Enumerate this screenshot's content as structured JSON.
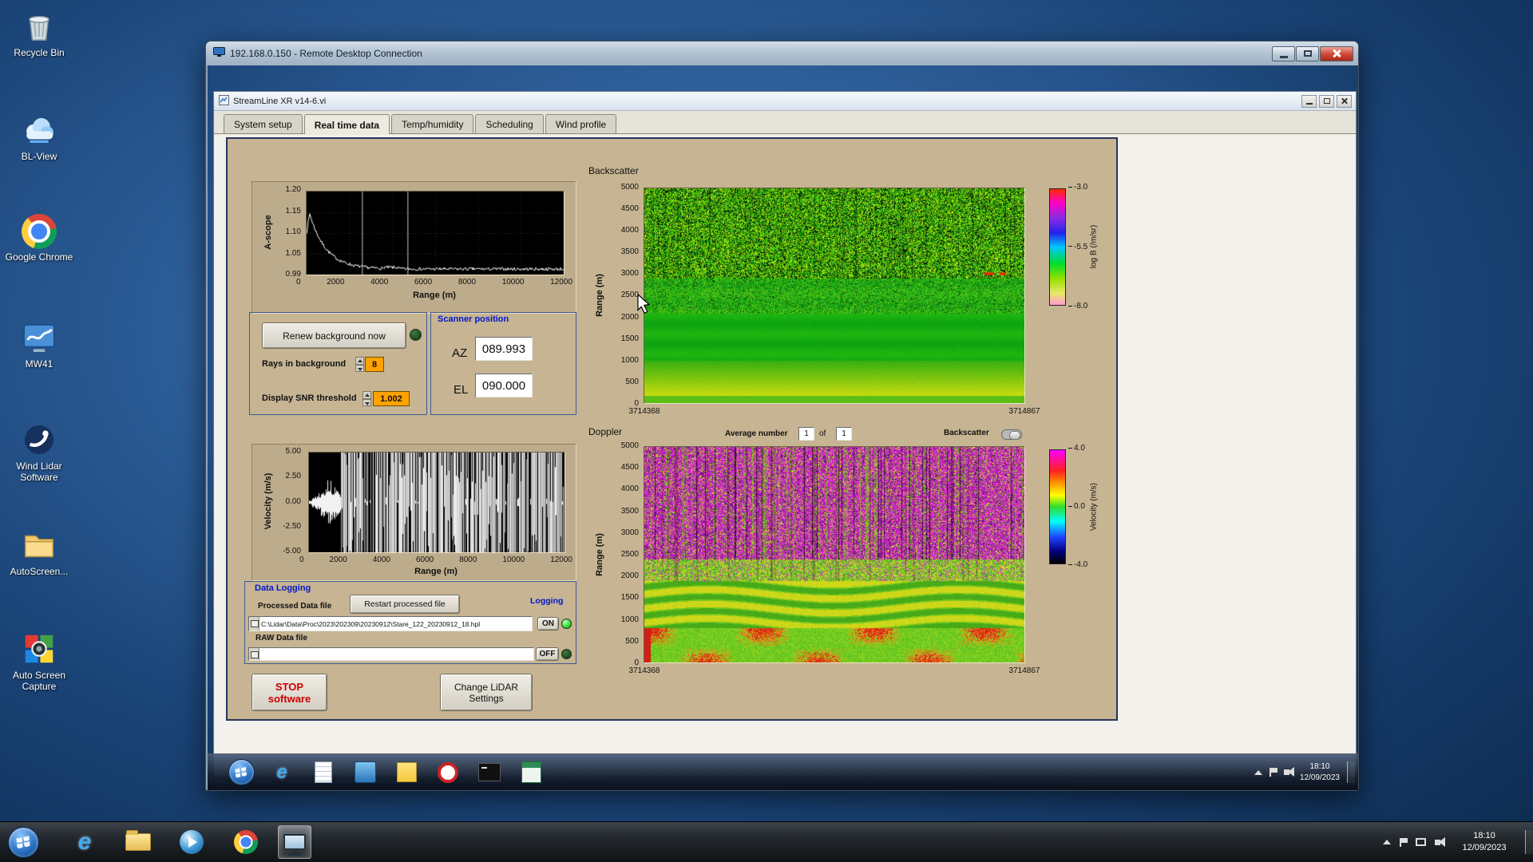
{
  "desktop": {
    "icons": [
      {
        "label": "Recycle Bin"
      },
      {
        "label": "BL-View"
      },
      {
        "label": "Google Chrome"
      },
      {
        "label": "MW41"
      },
      {
        "label": "Wind Lidar Software"
      },
      {
        "label": "AutoScreen..."
      },
      {
        "label": "Auto Screen Capture"
      }
    ]
  },
  "glyphs": {
    "ie": "e"
  },
  "rdp": {
    "title": "192.168.0.150 - Remote Desktop Connection"
  },
  "app": {
    "title": "StreamLine XR v14-6.vi",
    "tabs": [
      {
        "label": "System setup"
      },
      {
        "label": "Real time data"
      },
      {
        "label": "Temp/humidity"
      },
      {
        "label": "Scheduling"
      },
      {
        "label": "Wind profile"
      }
    ]
  },
  "ascope": {
    "y_label": "A-scope",
    "x_label": "Range (m)",
    "y_ticks": [
      "1.20",
      "1.15",
      "1.10",
      "1.05",
      "0.99"
    ],
    "x_ticks": [
      "0",
      "2000",
      "4000",
      "6000",
      "8000",
      "10000",
      "12000"
    ]
  },
  "background_ctrl": {
    "renew": "Renew background now",
    "rays_label": "Rays in background",
    "rays_value": "8",
    "snr_label": "Display SNR threshold",
    "snr_value": "1.002"
  },
  "scanner": {
    "title": "Scanner position",
    "az_label": "AZ",
    "az_value": "089.993",
    "el_label": "EL",
    "el_value": "090.000"
  },
  "backscatter": {
    "title": "Backscatter",
    "y_label": "Range (m)",
    "y_ticks": [
      "5000",
      "4500",
      "4000",
      "3500",
      "3000",
      "2500",
      "2000",
      "1500",
      "1000",
      "500",
      "0"
    ],
    "x_left": "3714368",
    "x_right": "3714867",
    "cb_label": "log B (/m/sr)",
    "cb_ticks": [
      "-3.0",
      "-5.5",
      "-8.0"
    ]
  },
  "doppler": {
    "title": "Doppler",
    "avg_label": "Average number",
    "avg_value": "1",
    "of_label": "of",
    "of_value": "1",
    "toggle_label": "Backscatter",
    "y_label": "Range (m)",
    "y_ticks": [
      "5000",
      "4500",
      "4000",
      "3500",
      "3000",
      "2500",
      "2000",
      "1500",
      "1000",
      "500",
      "0"
    ],
    "x_left": "3714368",
    "x_right": "3714867",
    "cb_label": "Velocity (m/s)",
    "cb_ticks": [
      "4.0",
      "0.0",
      "-4.0"
    ]
  },
  "velocity": {
    "y_label": "Velocity (m/s)",
    "x_label": "Range (m)",
    "y_ticks": [
      "5.00",
      "2.50",
      "0.00",
      "-2.50",
      "-5.00"
    ],
    "x_ticks": [
      "0",
      "2000",
      "4000",
      "6000",
      "8000",
      "10000",
      "12000"
    ]
  },
  "logging": {
    "title": "Data Logging",
    "processed_label": "Processed Data file",
    "restart": "Restart processed file",
    "logging_label": "Logging",
    "processed_path": "C:\\Lidar\\Data\\Proc\\2023\\202309\\20230912\\Stare_122_20230912_18.hpl",
    "on": "ON",
    "raw_label": "RAW Data file",
    "raw_path": "",
    "off": "OFF"
  },
  "footer": {
    "stop": "STOP software",
    "settings": "Change LiDAR Settings"
  },
  "remote_taskbar": {
    "time": "18:10",
    "date": "12/09/2023"
  },
  "host_taskbar": {
    "time": "18:10",
    "date": "12/09/2023"
  }
}
